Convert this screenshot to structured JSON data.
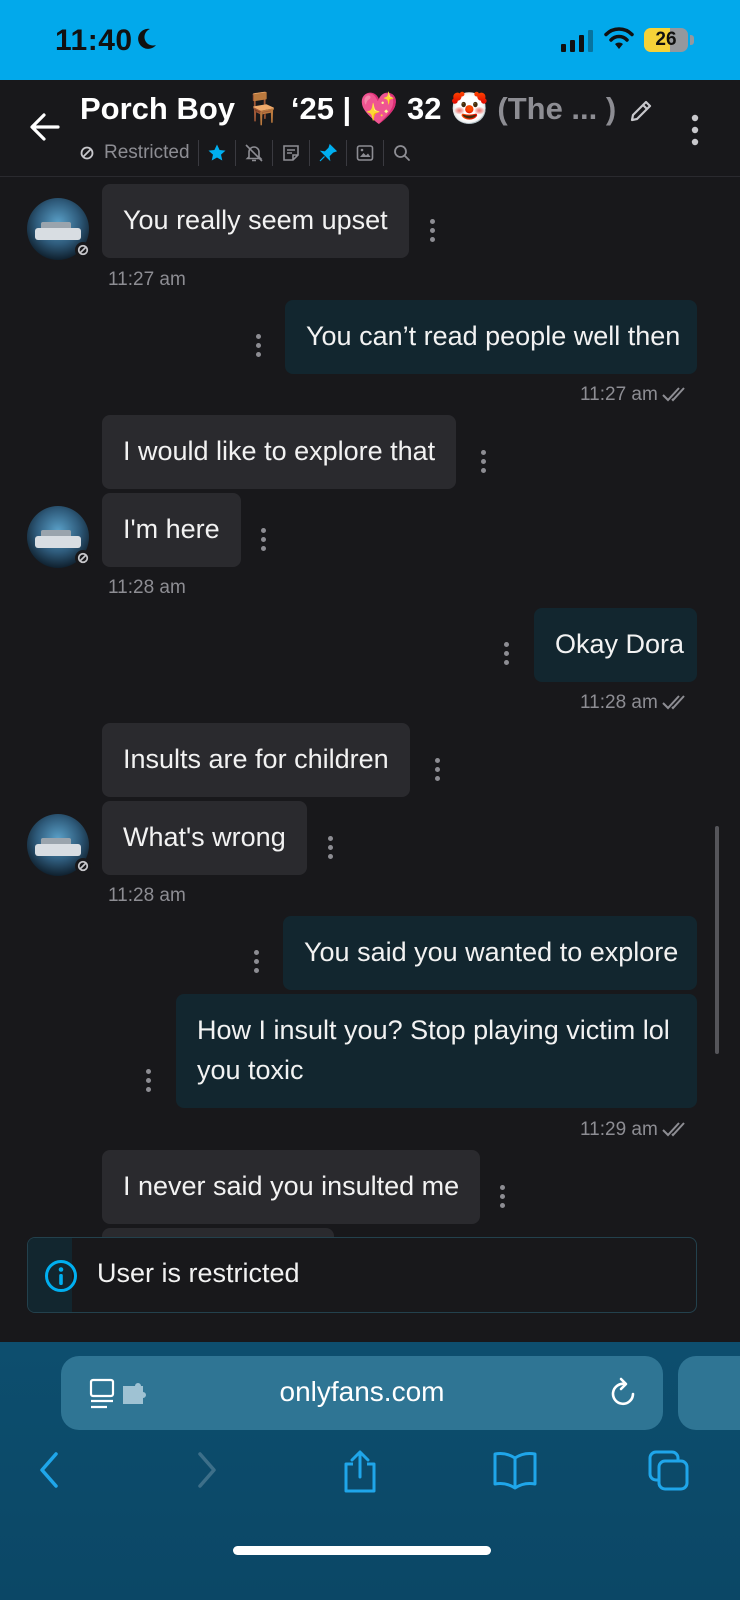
{
  "status_bar": {
    "time": "11:40",
    "battery": "26",
    "battery_level": 0.26
  },
  "header": {
    "title_main": "Porch Boy 🪑 ‘25 | 💖 32 🤡 ",
    "title_dim": "(The ... )",
    "status_label": "Restricted"
  },
  "messages": [
    {
      "side": "in",
      "text": "You really seem upset"
    },
    {
      "side": "in",
      "text": "11:27 am",
      "kind": "timestamp"
    },
    {
      "side": "out",
      "text": "You can’t read people well then"
    },
    {
      "side": "out",
      "text": "11:27 am",
      "kind": "timestamp"
    },
    {
      "side": "in",
      "text": "I would like to explore that"
    },
    {
      "side": "in",
      "text": "I'm here"
    },
    {
      "side": "in",
      "text": "11:28 am",
      "kind": "timestamp"
    },
    {
      "side": "out",
      "text": "Okay Dora"
    },
    {
      "side": "out",
      "text": "11:28 am",
      "kind": "timestamp"
    },
    {
      "side": "in",
      "text": "Insults are for children"
    },
    {
      "side": "in",
      "text": "What's wrong"
    },
    {
      "side": "in",
      "text": "11:28 am",
      "kind": "timestamp"
    },
    {
      "side": "out",
      "text": "You said you wanted to explore"
    },
    {
      "side": "out",
      "text": "How I insult you? Stop playing victim lol"
    },
    {
      "side": "out",
      "text": "you toxic"
    },
    {
      "side": "out",
      "text": "11:29 am",
      "kind": "timestamp"
    },
    {
      "side": "in",
      "text": "I never said you insulted me"
    }
  ],
  "restricted_banner": {
    "text": "User is restricted"
  },
  "browser": {
    "url": "onlyfans.com"
  },
  "colors": {
    "status_bar": "#02a9eb",
    "background": "#18181b",
    "incoming_bubble": "#2a2a2e",
    "outgoing_bubble": "#12262f",
    "accent": "#00aff0",
    "browser_bar": "#0d4e6e"
  },
  "icons": [
    "back-arrow-icon",
    "edit-icon",
    "more-vertical-icon",
    "restricted-icon",
    "star-icon",
    "bell-off-icon",
    "note-icon",
    "pin-icon",
    "media-icon",
    "search-icon",
    "info-icon",
    "read-receipt-icon",
    "reader-icon",
    "reload-icon",
    "back-icon",
    "forward-icon",
    "share-icon",
    "bookmarks-icon",
    "tabs-icon"
  ]
}
